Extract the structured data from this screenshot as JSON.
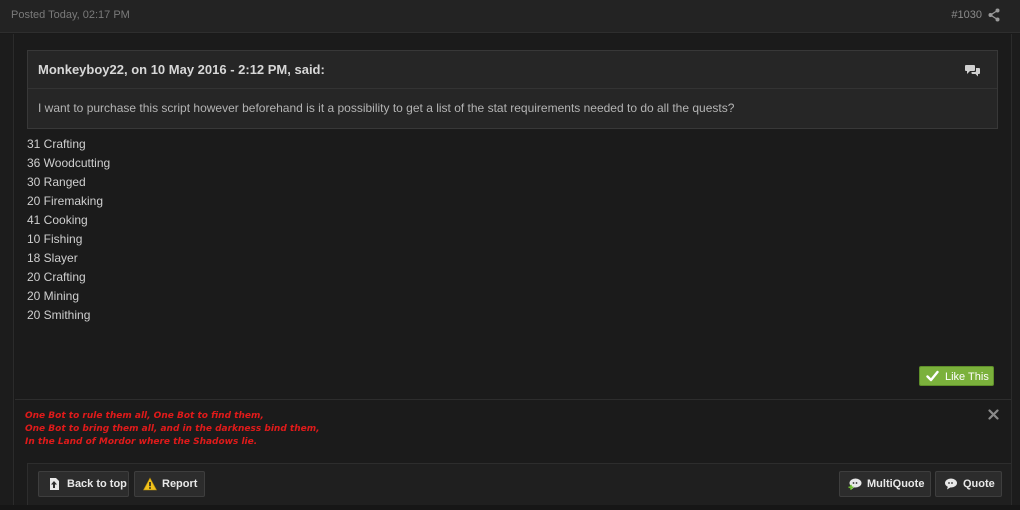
{
  "post": {
    "posted": "Posted Today, 02:17 PM",
    "number": "#1030"
  },
  "quote": {
    "citation": "Monkeyboy22, on 10 May 2016 - 2:12 PM, said:",
    "body": "I want to purchase this script however beforehand is it a possibility to get a list of the stat requirements needed to do all the quests?"
  },
  "stats": [
    "31 Crafting",
    "36 Woodcutting",
    "30 Ranged",
    "20 Firemaking",
    "41 Cooking",
    "10 Fishing",
    "18 Slayer",
    "20 Crafting",
    "20 Mining",
    "20 Smithing"
  ],
  "like_label": "Like This",
  "signature": [
    "One Bot to rule them all, One Bot to find them,",
    "One Bot to bring them all, and in the darkness bind them,",
    "In the Land of Mordor where the Shadows lie."
  ],
  "footer": {
    "back_to_top": "Back to top",
    "report": "Report",
    "multiquote": "MultiQuote",
    "quote": "Quote"
  },
  "colors": {
    "like_green": "#7bb13c",
    "signature_red": "#e01a1a",
    "background": "#1a1a1a"
  },
  "icons": [
    "share-icon",
    "quote-bubble-icon",
    "checkmark-icon",
    "close-icon",
    "back-to-top-icon",
    "warning-icon",
    "multiquote-icon",
    "quote-icon"
  ]
}
